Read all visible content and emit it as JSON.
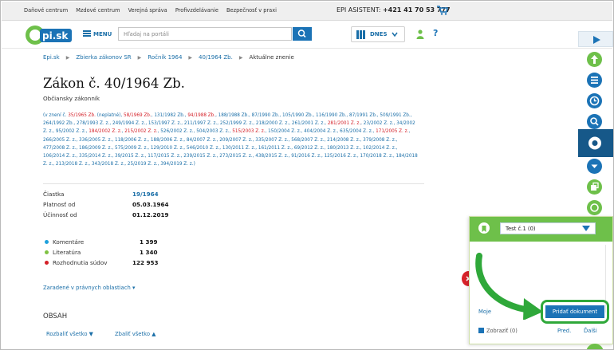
{
  "topbar": {
    "links": [
      "Daňové centrum",
      "Mzdové centrum",
      "Verejná správa",
      "Profivzdelávanie",
      "Bezpečnosť v praxi"
    ],
    "assistant_label": "EPI ASISTENT:",
    "assistant_phone": "+421 41 70 53 777"
  },
  "header": {
    "logo_text": "epi.sk",
    "menu_label": "MENU",
    "search_placeholder": "Hľadaj na portáli",
    "date_label": "DNES",
    "help_label": "?"
  },
  "breadcrumb": [
    "Epi.sk",
    "Zbierka zákonov SR",
    "Ročník 1964",
    "40/1964 Zb.",
    "Aktuálne znenie"
  ],
  "document": {
    "title": "Zákon č. 40/1964 Zb.",
    "subtitle": "Občiansky zákonník",
    "amendments": "(v znení č. 35/1965 Zb. (neplatné), 58/1969 Zb., 131/1982 Zb., 94/1988 Zb., 188/1988 Zb., 87/1990 Zb., 105/1990 Zb., 116/1990 Zb., 87/1991 Zb., 509/1991 Zb., 264/1992 Zb., 278/1993 Z. z., 249/1994 Z. z., 153/1997 Z. z., 211/1997 Z. z., 252/1999 Z. z., 218/2000 Z. z., 261/2001 Z. z., 281/2001 Z. z., 23/2002 Z. z., 34/2002 Z. z., 95/2002 Z. z., 184/2002 Z. z., 215/2002 Z. z., 526/2002 Z. z., 504/2003 Z. z., 515/2003 Z. z., 150/2004 Z. z., 404/2004 Z. z., 635/2004 Z. z., 171/2005 Z. z., 266/2005 Z. z., 336/2005 Z. z., 118/2006 Z. z., 188/2006 Z. z., 84/2007 Z. z., 209/2007 Z. z., 335/2007 Z. z., 568/2007 Z. z., 214/2008 Z. z., 379/2008 Z. z., 477/2008 Z. z., 186/2009 Z. z., 575/2009 Z. z., 129/2010 Z. z., 546/2010 Z. z., 130/2011 Z. z., 161/2011 Z. z., 69/2012 Z. z., 180/2013 Z. z., 102/2014 Z. z., 106/2014 Z. z., 335/2014 Z. z., 39/2015 Z. z., 117/2015 Z. z., 239/2015 Z. z., 273/2015 Z. z., 438/2015 Z. z., 91/2016 Z. z., 125/2016 Z. z., 170/2018 Z. z., 184/2018 Z. z., 213/2018 Z. z., 343/2018 Z. z., 25/2019 Z. z., 394/2019 Z. z.)",
    "meta": [
      {
        "label": "Čiastka",
        "value": "19/1964"
      },
      {
        "label": "Platnosť od",
        "value": "05.03.1964"
      },
      {
        "label": "Účinnosť od",
        "value": "01.12.2019"
      }
    ],
    "stats": [
      {
        "label": "Komentáre",
        "value": "1 399",
        "color": "#1ea0dc"
      },
      {
        "label": "Literatúra",
        "value": "1 340",
        "color": "#7fc242"
      },
      {
        "label": "Rozhodnutia súdov",
        "value": "122 953",
        "color": "#d41f27"
      }
    ],
    "areas_link": "Zaradené v právnych oblastiach",
    "toc_heading": "OBSAH",
    "expand_all": "Rozbaliť všetko",
    "collapse_all": "Zbaliť všetko"
  },
  "panel": {
    "selected_test": "Test č.1 (0)",
    "moje_label": "Moje",
    "add_button": "Pridať dokument",
    "show_label": "Zobraziť (0)",
    "prev_label": "Pred.",
    "next_label": "Ďalši"
  },
  "colors": {
    "link_blue": "#1b6fa8",
    "accent_blue": "#1b73b6",
    "dark_blue": "#165889",
    "green": "#6ec04a",
    "red": "#d41f27",
    "sidebar_colors": [
      "#1b73b6",
      "#6ec04a",
      "#1b73b6",
      "#1b73b6",
      "#1b73b6",
      "#165889",
      "#1b73b6",
      "#6ec04a",
      "#6ec04a"
    ]
  },
  "sidebar_icons": [
    "play-icon",
    "up-arrow-icon",
    "list-icon",
    "clock-icon",
    "search-icon",
    "circle-icon",
    "chevron-down-icon",
    "pages-icon",
    "refresh-icon"
  ]
}
